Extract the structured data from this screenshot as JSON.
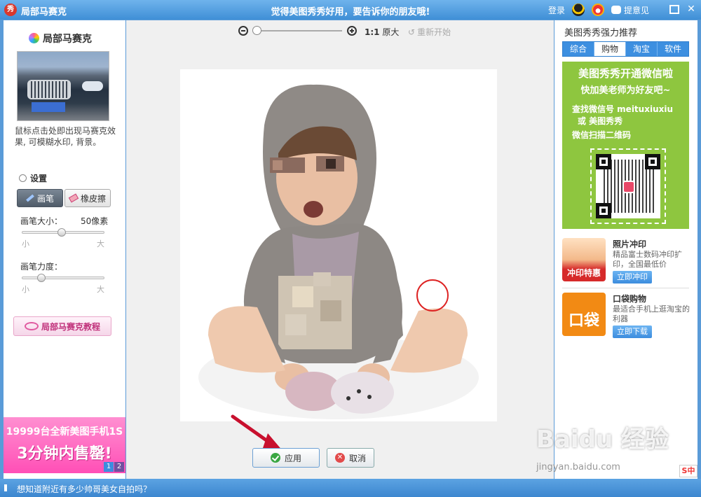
{
  "window": {
    "app_logo": "秀",
    "app_title": "局部马赛克",
    "slogan": "觉得美图秀秀好用，要告诉你的朋友哦!",
    "login": "登录",
    "feedback": "提意见"
  },
  "left_panel": {
    "title": "局部马赛克",
    "description": "鼠标点击处即出现马赛克效果, 可模糊水印, 背景。",
    "settings_title": "设置",
    "tools": [
      {
        "label": "画笔",
        "active": true
      },
      {
        "label": "橡皮擦",
        "active": false
      }
    ],
    "brush_size": {
      "label": "画笔大小：",
      "value": "50像素",
      "min_label": "小",
      "max_label": "大",
      "level": 0.47
    },
    "brush_strength": {
      "label": "画笔力度：",
      "min_label": "小",
      "max_label": "大",
      "level": 0.2
    },
    "tutorial_button": "局部马赛克教程",
    "ad": {
      "line1": "19999台全新美图手机1S",
      "line2": "3分钟内售罄!",
      "pages": [
        "1",
        "2"
      ]
    }
  },
  "toolbar": {
    "zoom_level": 0.0,
    "one_to_one_mark": "1:1",
    "original_size": "原大",
    "restart": "重新开始"
  },
  "canvas": {
    "apply": "应用",
    "cancel": "取消"
  },
  "right_panel": {
    "title": "美图秀秀强力推荐",
    "tabs": [
      {
        "label": "综合",
        "active": false
      },
      {
        "label": "购物",
        "active": true
      },
      {
        "label": "淘宝",
        "active": false
      },
      {
        "label": "软件",
        "active": false
      }
    ],
    "wechat_ad": {
      "line1": "美图秀秀开通微信啦",
      "line2": "快加美老师为好友吧~",
      "line3": "查找微信号 meituxiuxiu",
      "line4": "或  美图秀秀",
      "line5": "微信扫描二维码"
    },
    "promos": [
      {
        "title": "照片冲印",
        "desc": "精品富士数码冲印扩印，全国最低价",
        "button": "立即冲印",
        "image_text": "冲印特惠"
      },
      {
        "title": "口袋购物",
        "desc": "最适合手机上逛淘宝的利器",
        "button": "立即下载",
        "image_text": "口袋"
      }
    ]
  },
  "status_bar": {
    "text": "想知道附近有多少帅哥美女自拍吗？"
  },
  "watermark": {
    "logo": "Baidu 经验",
    "url": "jingyan.baidu.com"
  },
  "ime": "S中"
}
